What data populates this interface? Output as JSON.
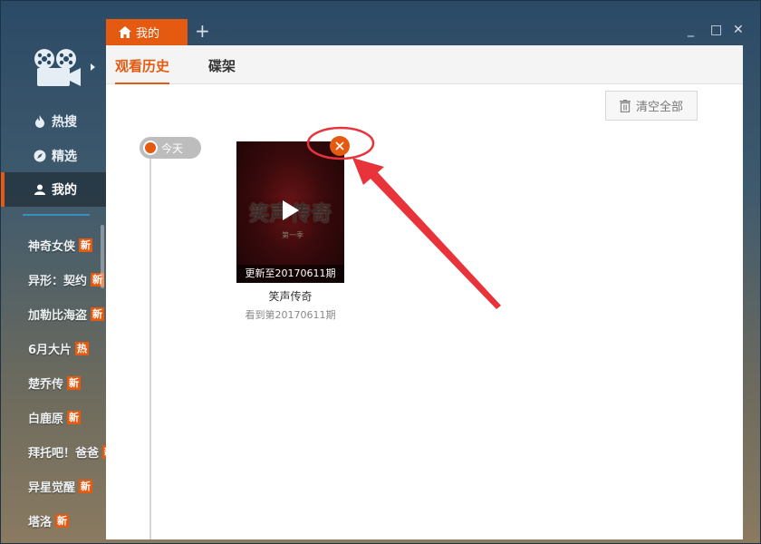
{
  "colors": {
    "accent": "#e35a10",
    "annotation": "#e8333a"
  },
  "tabbar": {
    "home_tab": "我的",
    "add_tab": "+",
    "minimize": "_",
    "maximize": "□",
    "close": "✕"
  },
  "sidebar": {
    "nav": [
      {
        "label": "热搜",
        "icon": "flame-icon"
      },
      {
        "label": "精选",
        "icon": "compass-icon"
      },
      {
        "label": "我的",
        "icon": "user-icon"
      }
    ],
    "shows": [
      {
        "label": "神奇女侠",
        "badge": "新"
      },
      {
        "label": "异形：契约",
        "badge": "新"
      },
      {
        "label": "加勒比海盗",
        "badge": "新"
      },
      {
        "label": "6月大片",
        "badge": "热"
      },
      {
        "label": "楚乔传",
        "badge": "新"
      },
      {
        "label": "白鹿原",
        "badge": "新"
      },
      {
        "label": "拜托吧！爸爸",
        "badge": "新"
      },
      {
        "label": "异星觉醒",
        "badge": "新"
      },
      {
        "label": "塔洛",
        "badge": "新"
      }
    ]
  },
  "main": {
    "subtabs": [
      {
        "label": "观看历史"
      },
      {
        "label": "碟架"
      }
    ],
    "clear_all": "清空全部",
    "timeline_label": "今天",
    "card": {
      "poster_title": "笑声传奇",
      "poster_sub": "第一季",
      "caption": "更新至20170611期",
      "title": "笑声传奇",
      "progress": "看到第20170611期"
    }
  }
}
